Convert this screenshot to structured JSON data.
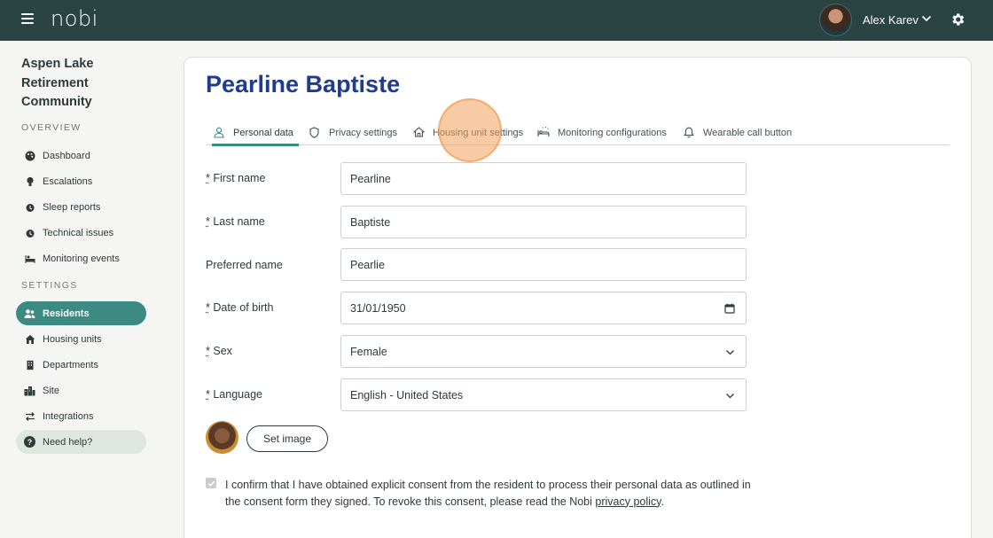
{
  "app": {
    "logo": "nobi"
  },
  "user": {
    "name": "Alex Karev"
  },
  "sidebar": {
    "community_name": "Aspen Lake Retirement Community",
    "overview_label": "OVERVIEW",
    "settings_label": "SETTINGS",
    "overview_items": [
      {
        "label": "Dashboard",
        "icon": "palette-icon"
      },
      {
        "label": "Escalations",
        "icon": "lightbulb-icon"
      },
      {
        "label": "Sleep reports",
        "icon": "alarm-clock-icon"
      },
      {
        "label": "Technical issues",
        "icon": "alarm-clock-icon"
      },
      {
        "label": "Monitoring events",
        "icon": "bed-person-icon"
      }
    ],
    "settings_items": [
      {
        "label": "Residents",
        "icon": "users-icon",
        "active": true
      },
      {
        "label": "Housing units",
        "icon": "house-icon"
      },
      {
        "label": "Departments",
        "icon": "building-icon"
      },
      {
        "label": "Site",
        "icon": "city-icon"
      },
      {
        "label": "Integrations",
        "icon": "arrows-exchange-icon"
      }
    ],
    "help_label": "Need help?"
  },
  "resident": {
    "name": "Pearline Baptiste"
  },
  "tabs": [
    {
      "label": "Personal data",
      "icon": "person-icon",
      "active": true
    },
    {
      "label": "Privacy settings",
      "icon": "shield-icon"
    },
    {
      "label": "Housing unit settings",
      "icon": "house-outline-icon"
    },
    {
      "label": "Monitoring configurations",
      "icon": "bed-alert-icon"
    },
    {
      "label": "Wearable call button",
      "icon": "bell-icon"
    }
  ],
  "form": {
    "first_name": {
      "required_mark": "*",
      "label": "First name",
      "value": "Pearline"
    },
    "last_name": {
      "required_mark": "*",
      "label": "Last name",
      "value": "Baptiste"
    },
    "preferred_name": {
      "label": "Preferred name",
      "value": "Pearlie"
    },
    "date_of_birth": {
      "required_mark": "*",
      "label": "Date of birth",
      "value": "31/01/1950"
    },
    "sex": {
      "required_mark": "*",
      "label": "Sex",
      "value": "Female"
    },
    "language": {
      "required_mark": "*",
      "label": "Language",
      "value": "English - United States"
    },
    "set_image_label": "Set image",
    "consent": {
      "checked": true,
      "text": "I confirm that I have obtained explicit consent from the resident to process their personal data as outlined in the consent form they signed. To revoke this consent, please read the Nobi ",
      "link_text": "privacy policy",
      "suffix": "."
    }
  },
  "colors": {
    "topbar": "#2a4443",
    "accent": "#3d8a83",
    "title": "#1f3c8f",
    "highlight": "#f2a05a"
  }
}
